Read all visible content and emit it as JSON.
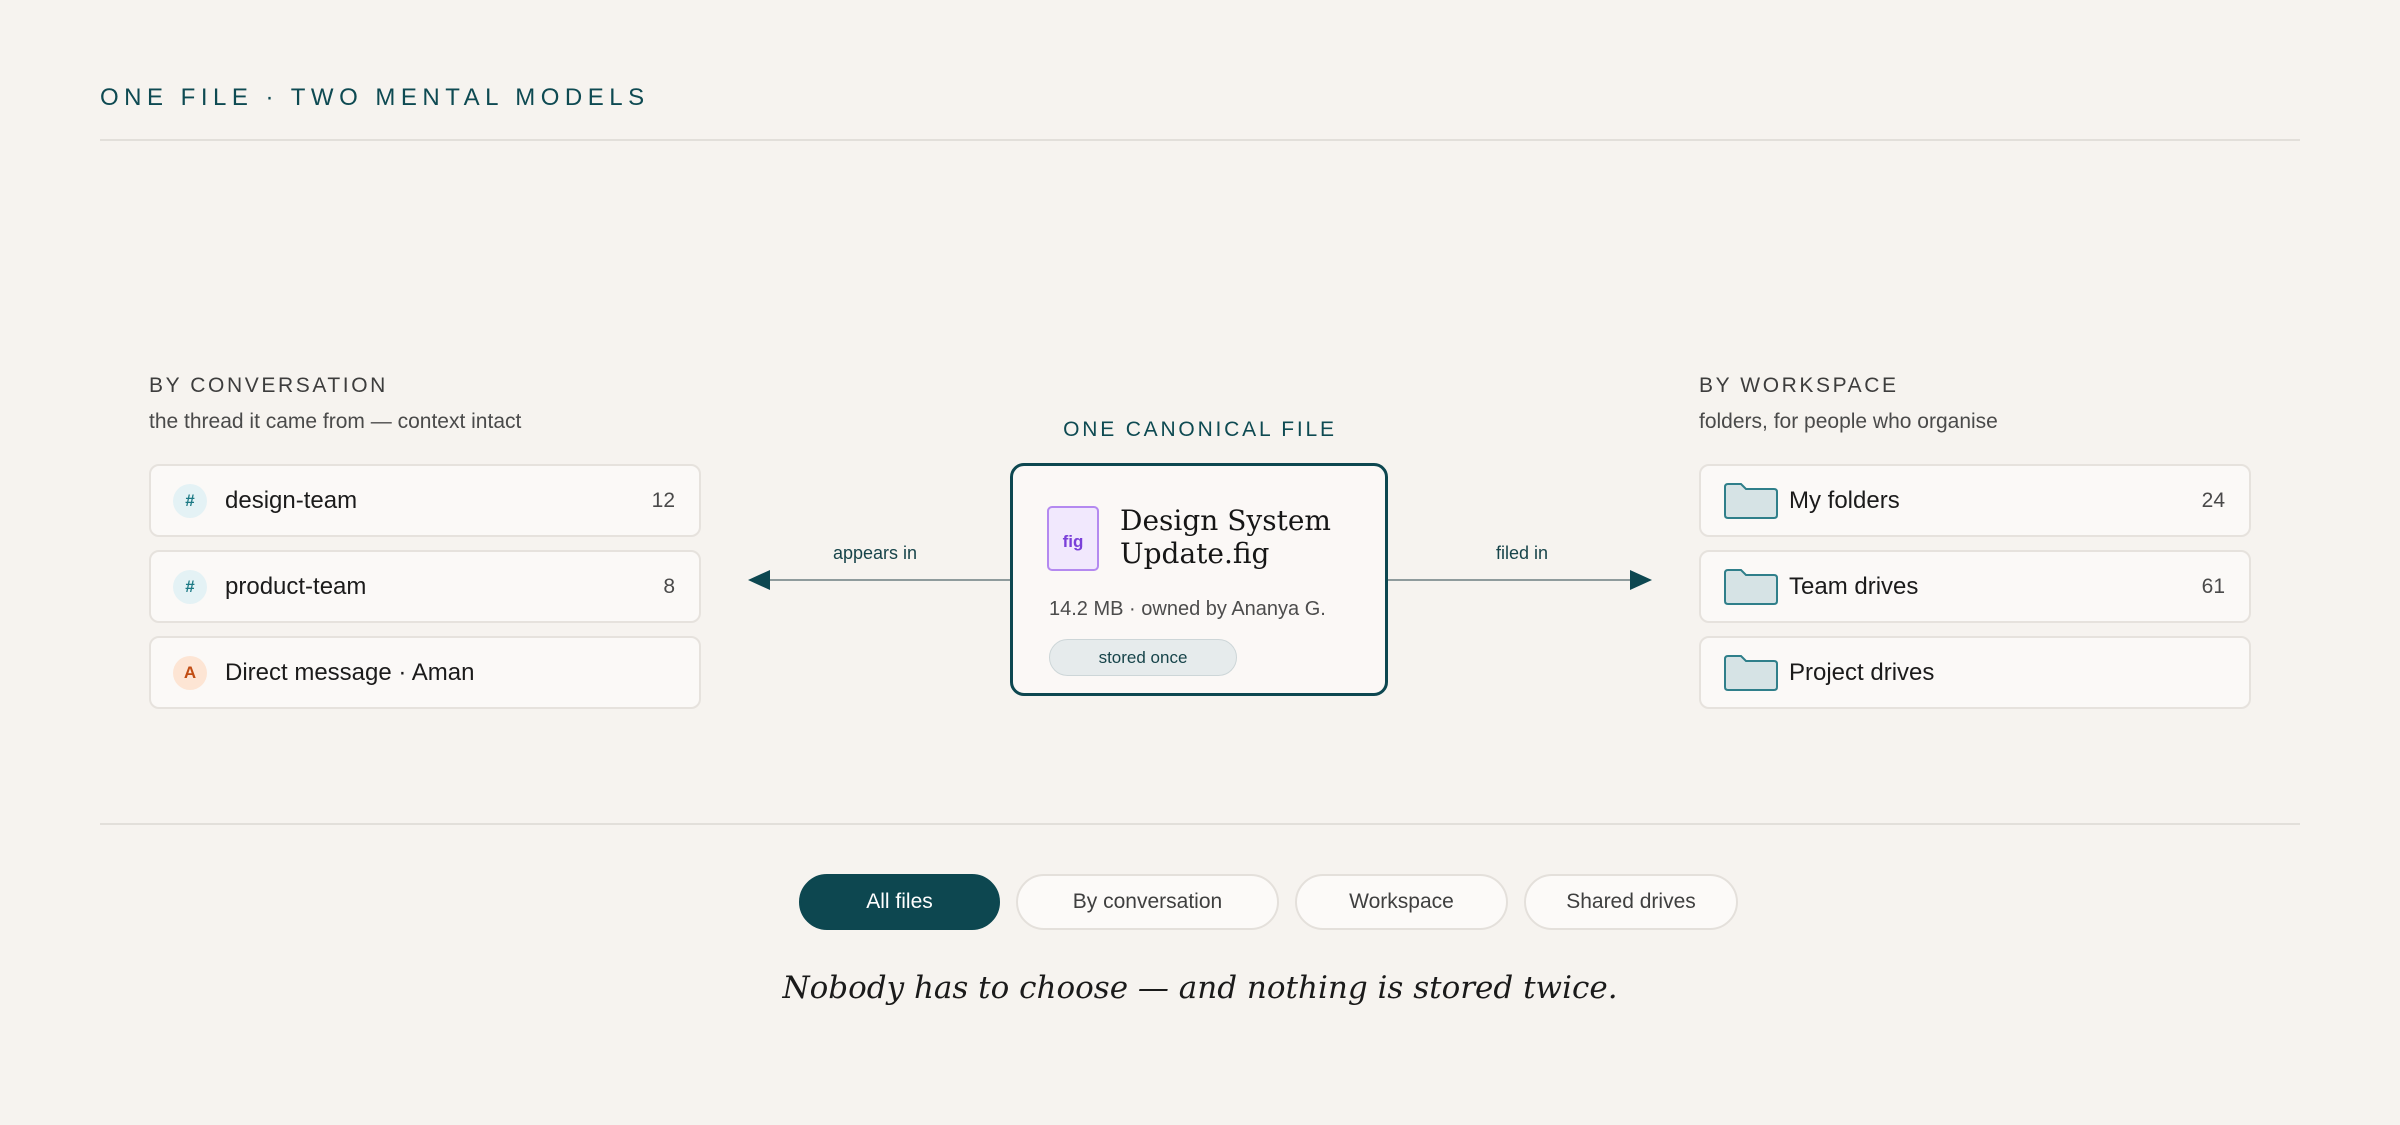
{
  "header": {
    "eyebrow": "ONE FILE · TWO MENTAL MODELS"
  },
  "conversation": {
    "title": "BY CONVERSATION",
    "subtitle": "the thread it came from — context intact",
    "items": [
      {
        "badge": "#",
        "label": "design-team",
        "count": "12",
        "icon": "channel-hash-icon"
      },
      {
        "badge": "#",
        "label": "product-team",
        "count": "8",
        "icon": "channel-hash-icon"
      },
      {
        "badge": "A",
        "label": "Direct message · Aman",
        "count": "",
        "icon": "user-avatar"
      }
    ]
  },
  "canonical": {
    "label": "ONE CANONICAL FILE",
    "file_type": "fig",
    "file_name": "Design System Update.fig",
    "meta": "14.2 MB · owned by Ananya G.",
    "badge": "stored once"
  },
  "connectors": {
    "left_label": "appears in",
    "right_label": "filed in"
  },
  "workspace": {
    "title": "BY WORKSPACE",
    "subtitle": "folders, for people who organise",
    "items": [
      {
        "label": "My folders",
        "count": "24",
        "icon": "folder-icon"
      },
      {
        "label": "Team drives",
        "count": "61",
        "icon": "folder-icon"
      },
      {
        "label": "Project drives",
        "count": "",
        "icon": "folder-icon"
      }
    ]
  },
  "tabs": [
    {
      "label": "All files",
      "active": true
    },
    {
      "label": "By conversation",
      "active": false
    },
    {
      "label": "Workspace",
      "active": false
    },
    {
      "label": "Shared drives",
      "active": false
    }
  ],
  "tagline": "Nobody has to choose — and nothing is stored twice.",
  "colors": {
    "accent": "#0d4750",
    "background": "#f6f3ef",
    "file_purple": "#7a3fd9"
  }
}
